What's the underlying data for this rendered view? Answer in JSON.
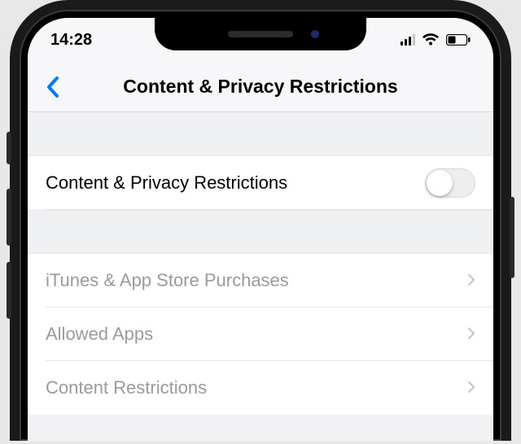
{
  "statusbar": {
    "time": "14:28"
  },
  "header": {
    "title": "Content & Privacy Restrictions"
  },
  "rows": {
    "master_toggle_label": "Content & Privacy Restrictions",
    "itunes_label": "iTunes & App Store Purchases",
    "allowed_apps_label": "Allowed Apps",
    "content_restrictions_label": "Content Restrictions"
  }
}
